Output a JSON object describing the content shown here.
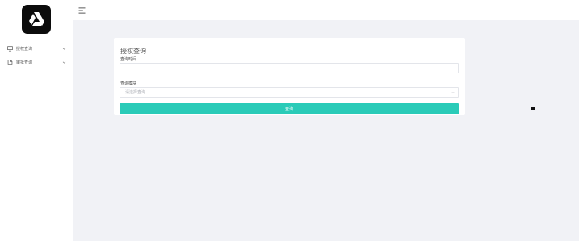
{
  "sidebar": {
    "logo_icon": "drive-triangle-icon",
    "items": [
      {
        "label": "授权查询",
        "icon": "monitor-icon"
      },
      {
        "label": "审批查询",
        "icon": "document-icon"
      }
    ]
  },
  "topbar": {
    "menu_icon": "hamburger-icon"
  },
  "form": {
    "title": "授权查询",
    "time_label": "查询时间",
    "time_value": "",
    "module_label": "查询模块",
    "module_placeholder": "请选择查询",
    "submit_label": "查询"
  },
  "colors": {
    "accent": "#2acbb8",
    "background": "#f1f2f6",
    "logo_bg": "#0c0c0c"
  }
}
